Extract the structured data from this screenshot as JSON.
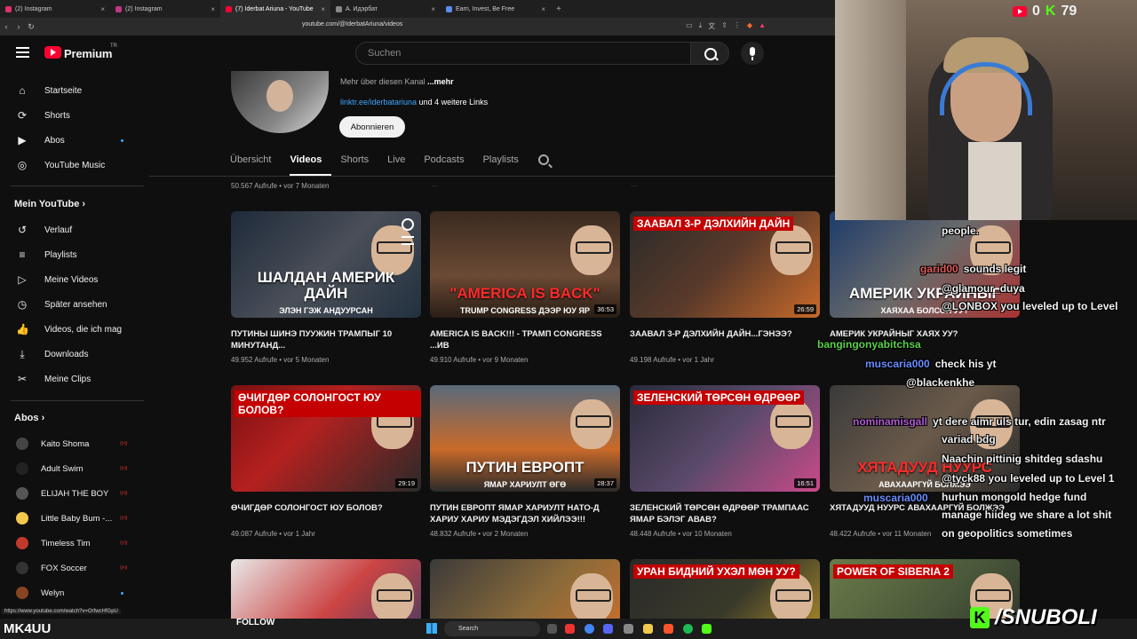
{
  "browser": {
    "tabs": [
      {
        "label": "(2) Instagram",
        "color": "#e1306c"
      },
      {
        "label": "(2) Instagram",
        "color": "#c13584"
      },
      {
        "label": "(7) Iderbat Ariuna - YouTube",
        "color": "#ff0033",
        "active": true
      },
      {
        "label": "A. Идэрбат",
        "color": "#888888"
      },
      {
        "label": "Earn, Invest, Be Free",
        "color": "#5b8def"
      }
    ],
    "url": "youtube.com/@IderbatAriuna/videos",
    "status_url": "https://www.youtube.com/watch?v=OrfwcHfGpU"
  },
  "masthead": {
    "brand": "Premium",
    "brand_sup": "TR",
    "search_placeholder": "Suchen"
  },
  "sidebar": {
    "main": [
      {
        "label": "Startseite",
        "icon": "home-icon",
        "glyph": "⌂"
      },
      {
        "label": "Shorts",
        "icon": "shorts-icon",
        "glyph": "⟳"
      },
      {
        "label": "Abos",
        "icon": "subscriptions-icon",
        "glyph": "▶"
      },
      {
        "label": "YouTube Music",
        "icon": "music-icon",
        "glyph": "◎"
      }
    ],
    "you_heading": "Mein YouTube",
    "you": [
      {
        "label": "Verlauf",
        "icon": "history-icon",
        "glyph": "↺"
      },
      {
        "label": "Playlists",
        "icon": "playlists-icon",
        "glyph": "≡"
      },
      {
        "label": "Meine Videos",
        "icon": "my-videos-icon",
        "glyph": "▷"
      },
      {
        "label": "Später ansehen",
        "icon": "watch-later-icon",
        "glyph": "◷"
      },
      {
        "label": "Videos, die ich mag",
        "icon": "like-icon",
        "glyph": "👍"
      },
      {
        "label": "Downloads",
        "icon": "download-icon",
        "glyph": "⤓"
      },
      {
        "label": "Meine Clips",
        "icon": "clips-icon",
        "glyph": "✂"
      }
    ],
    "subs_heading": "Abos",
    "subs": [
      {
        "label": "Kaito Shoma",
        "color": "#444444",
        "live": true
      },
      {
        "label": "Adult Swim",
        "color": "#222222",
        "live": true
      },
      {
        "label": "ELIJAH THE BOY",
        "color": "#555555",
        "live": true
      },
      {
        "label": "Little Baby Bum -...",
        "color": "#f2c94c",
        "live": true
      },
      {
        "label": "Timeless Tim",
        "color": "#c0392b",
        "live": true
      },
      {
        "label": "FOX Soccer",
        "color": "#333333",
        "live": true
      },
      {
        "label": "Welyn",
        "color": "#884422",
        "live": false
      }
    ]
  },
  "channel": {
    "about_prefix": "Mehr über diesen Kanal",
    "about_more": "...mehr",
    "link": "linktr.ee/iderbatariuna",
    "link_suffix": "und 4 weitere Links",
    "subscribe": "Abonnieren",
    "tabs": [
      "Übersicht",
      "Videos",
      "Shorts",
      "Live",
      "Podcasts",
      "Playlists"
    ],
    "active_tab": "Videos"
  },
  "prev_row_meta": [
    "50.567 Aufrufe • vor 7 Monaten"
  ],
  "videos": [
    {
      "title": "ПУТИНЫ ШИНЭ ПУУЖИН ТРАМПЫГ 10 МИНУТАНД...",
      "meta": "49.952 Aufrufe • vor 5 Monaten",
      "duration": "",
      "cap": "ШАЛДАН АМЕРИК ДАЙН",
      "cap2": "ЭЛЭН ГЭЖ АНДУУРСАН",
      "bg": "linear-gradient(135deg,#1e2a3a,#4a4f58 50%,#22303f)",
      "capred": false,
      "topcap": ""
    },
    {
      "title": "AMERICA IS BACK!!! - ТРАМП CONGRESS ...ИВ",
      "meta": "49.910 Aufrufe • vor 9 Monaten",
      "duration": "36:53",
      "cap": "\"AMERICA IS BACK\"",
      "cap2": "TRUMP CONGRESS ДЭЭР ЮУ ЯР",
      "bg": "linear-gradient(180deg,#3a2a1f,#6b4a35 60%,#2a1e16)",
      "capred": true,
      "topcap": ""
    },
    {
      "title": "ЗААВАЛ 3-Р ДЭЛХИЙН ДАЙН...ГЭНЭЭ?",
      "meta": "49.198 Aufrufe • vor 1 Jahr",
      "duration": "26:59",
      "cap": "",
      "cap2": "",
      "bg": "linear-gradient(135deg,#2a2a2a,#5a3a2a 50%,#c86a2a)",
      "capred": false,
      "topcap": "ЗААВАЛ 3-Р ДЭЛХИЙН ДАЙН"
    },
    {
      "title": "АМЕРИК УКРАЙНЫГ ХАЯХ УУ?",
      "meta": "",
      "duration": "",
      "cap": "АМЕРИК УКРАЙНЫГ",
      "cap2": "ХАЯХАА БОЛСОН УУ?",
      "bg": "linear-gradient(135deg,#1d3b6a,#6a6a6a 50%,#a33)",
      "capred": false,
      "topcap": ""
    },
    {
      "title": "ӨЧИГДӨР СОЛОНГОСТ ЮУ БОЛОВ?",
      "meta": "49.087 Aufrufe • vor 1 Jahr",
      "duration": "29:19",
      "cap": "",
      "cap2": "",
      "bg": "linear-gradient(135deg,#7a1010,#b52020 40%,#2a2a2a)",
      "capred": false,
      "topcap": "ӨЧИГДӨР СОЛОНГОСТ ЮУ БОЛОВ?"
    },
    {
      "title": "ПУТИН ЕВРОПТ ЯМАР ХАРИУЛТ НАТО-Д ХАРИУ ХАРИУ МЭДЭГДЭЛ ХИЙЛЭЭ!!!",
      "meta": "48.832 Aufrufe • vor 2 Monaten",
      "duration": "28:37",
      "cap": "ПУТИН ЕВРОПТ",
      "cap2": "ЯМАР ХАРИУЛТ ӨГӨ",
      "bg": "linear-gradient(180deg,#5a6a7a,#c96a2a 60%,#2a2a2a)",
      "capred": false,
      "topcap": ""
    },
    {
      "title": "ЗЕЛЕНСКИЙ ТӨРСӨН ӨДРӨӨР ТРАМПААС ЯМАР БЭЛЭГ АВАВ?",
      "meta": "48.448 Aufrufe • vor 10 Monaten",
      "duration": "16:51",
      "cap": "",
      "cap2": "",
      "bg": "linear-gradient(135deg,#2a2a3a,#5a4a6a 50%,#c94a8a)",
      "capred": false,
      "topcap": "ЗЕЛЕНСКИЙ ТӨРСӨН ӨДРӨӨР"
    },
    {
      "title": "ХЯТАДУУД НУУРС АВАХААРГҮЙ БОЛЖЭЭ",
      "meta": "48.422 Aufrufe • vor 11 Monaten",
      "duration": "",
      "cap": "ХЯТАДУУД НУУРС",
      "cap2": "АВАХААРГҮЙ БОЛЖЭЭ",
      "bg": "linear-gradient(135deg,#3a3a3a,#6a5a4a 50%,#2a2a2a)",
      "capred": true,
      "topcap": ""
    },
    {
      "title": "",
      "meta": "",
      "duration": "",
      "cap": "",
      "cap2": "",
      "bg": "linear-gradient(135deg,#e8e8e8,#c44 50%,#2a3a6a)",
      "capred": false,
      "topcap": ""
    },
    {
      "title": "",
      "meta": "",
      "duration": "",
      "cap": "",
      "cap2": "",
      "bg": "linear-gradient(135deg,#3a3a3a,#8a6a3a 50%,#d8702a)",
      "capred": false,
      "topcap": ""
    },
    {
      "title": "",
      "meta": "",
      "duration": "",
      "cap": "",
      "cap2": "",
      "bg": "linear-gradient(135deg,#2a2a2a,#3a3a2a 50%,#c8a02a)",
      "capred": false,
      "topcap": "УРАН БИДНИЙ УХЭЛ МӨН УУ?"
    },
    {
      "title": "",
      "meta": "",
      "duration": "",
      "cap": "",
      "cap2": "",
      "bg": "linear-gradient(135deg,#6a7a4a,#4a5a3a 50%,#2a2a2a)",
      "capred": false,
      "topcap": "POWER OF SIBERIA 2"
    }
  ],
  "stream": {
    "youtube_viewers": "0",
    "kick_viewers": "79",
    "streamer_tag": "MK4UU",
    "follow": "FOLLOW",
    "handle": "/SNUBOLI"
  },
  "chat": [
    {
      "user": "",
      "msg": "people.",
      "ucolor": "#ffffff"
    },
    {
      "user": "garid00",
      "msg": "sounds legit",
      "ucolor": "#e05a5a"
    },
    {
      "user": "",
      "msg": "@glamour_duya",
      "ucolor": "#ffffff"
    },
    {
      "user": "",
      "msg": "@LONBOX you leveled up to Level",
      "ucolor": "#ffffff"
    },
    {
      "user": "bangingonyabitchsa",
      "msg": "",
      "ucolor": "#5ad14a"
    },
    {
      "user": "muscaria000",
      "msg": "check his yt",
      "ucolor": "#6a8cff"
    },
    {
      "user": "",
      "msg": "@blackenkhe",
      "ucolor": "#ffffff"
    },
    {
      "user": "nominamisgall",
      "msg": "yt dere aimr uls tur, edin zasag ntr",
      "ucolor": "#b05ad1"
    },
    {
      "user": "",
      "msg": "variad bdg",
      "ucolor": "#ffffff"
    },
    {
      "user": "",
      "msg": "Naachin pittinig shitdeg sdashu",
      "ucolor": "#ffffff"
    },
    {
      "user": "",
      "msg": "@tyck88 you leveled up to Level 1",
      "ucolor": "#ffffff"
    },
    {
      "user": "muscaria000",
      "msg": "",
      "ucolor": "#6a8cff"
    },
    {
      "user": "",
      "msg": "hurhun mongold hedge fund",
      "ucolor": "#ffffff"
    },
    {
      "user": "",
      "msg": "manage hiideg we share a lot shit",
      "ucolor": "#ffffff"
    },
    {
      "user": "",
      "msg": "on geopolitics sometimes",
      "ucolor": "#ffffff"
    }
  ]
}
